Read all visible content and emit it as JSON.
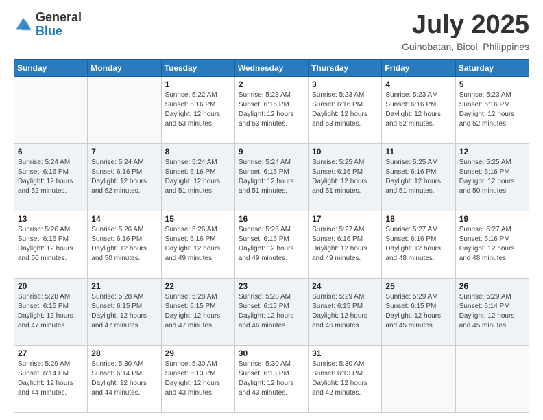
{
  "header": {
    "logo_general": "General",
    "logo_blue": "Blue",
    "month": "July 2025",
    "location": "Guinobatan, Bicol, Philippines"
  },
  "days_of_week": [
    "Sunday",
    "Monday",
    "Tuesday",
    "Wednesday",
    "Thursday",
    "Friday",
    "Saturday"
  ],
  "weeks": [
    [
      {
        "day": "",
        "sunrise": "",
        "sunset": "",
        "daylight": ""
      },
      {
        "day": "",
        "sunrise": "",
        "sunset": "",
        "daylight": ""
      },
      {
        "day": "1",
        "sunrise": "Sunrise: 5:22 AM",
        "sunset": "Sunset: 6:16 PM",
        "daylight": "Daylight: 12 hours and 53 minutes."
      },
      {
        "day": "2",
        "sunrise": "Sunrise: 5:23 AM",
        "sunset": "Sunset: 6:16 PM",
        "daylight": "Daylight: 12 hours and 53 minutes."
      },
      {
        "day": "3",
        "sunrise": "Sunrise: 5:23 AM",
        "sunset": "Sunset: 6:16 PM",
        "daylight": "Daylight: 12 hours and 53 minutes."
      },
      {
        "day": "4",
        "sunrise": "Sunrise: 5:23 AM",
        "sunset": "Sunset: 6:16 PM",
        "daylight": "Daylight: 12 hours and 52 minutes."
      },
      {
        "day": "5",
        "sunrise": "Sunrise: 5:23 AM",
        "sunset": "Sunset: 6:16 PM",
        "daylight": "Daylight: 12 hours and 52 minutes."
      }
    ],
    [
      {
        "day": "6",
        "sunrise": "Sunrise: 5:24 AM",
        "sunset": "Sunset: 6:16 PM",
        "daylight": "Daylight: 12 hours and 52 minutes."
      },
      {
        "day": "7",
        "sunrise": "Sunrise: 5:24 AM",
        "sunset": "Sunset: 6:16 PM",
        "daylight": "Daylight: 12 hours and 52 minutes."
      },
      {
        "day": "8",
        "sunrise": "Sunrise: 5:24 AM",
        "sunset": "Sunset: 6:16 PM",
        "daylight": "Daylight: 12 hours and 51 minutes."
      },
      {
        "day": "9",
        "sunrise": "Sunrise: 5:24 AM",
        "sunset": "Sunset: 6:16 PM",
        "daylight": "Daylight: 12 hours and 51 minutes."
      },
      {
        "day": "10",
        "sunrise": "Sunrise: 5:25 AM",
        "sunset": "Sunset: 6:16 PM",
        "daylight": "Daylight: 12 hours and 51 minutes."
      },
      {
        "day": "11",
        "sunrise": "Sunrise: 5:25 AM",
        "sunset": "Sunset: 6:16 PM",
        "daylight": "Daylight: 12 hours and 51 minutes."
      },
      {
        "day": "12",
        "sunrise": "Sunrise: 5:25 AM",
        "sunset": "Sunset: 6:16 PM",
        "daylight": "Daylight: 12 hours and 50 minutes."
      }
    ],
    [
      {
        "day": "13",
        "sunrise": "Sunrise: 5:26 AM",
        "sunset": "Sunset: 6:16 PM",
        "daylight": "Daylight: 12 hours and 50 minutes."
      },
      {
        "day": "14",
        "sunrise": "Sunrise: 5:26 AM",
        "sunset": "Sunset: 6:16 PM",
        "daylight": "Daylight: 12 hours and 50 minutes."
      },
      {
        "day": "15",
        "sunrise": "Sunrise: 5:26 AM",
        "sunset": "Sunset: 6:16 PM",
        "daylight": "Daylight: 12 hours and 49 minutes."
      },
      {
        "day": "16",
        "sunrise": "Sunrise: 5:26 AM",
        "sunset": "Sunset: 6:16 PM",
        "daylight": "Daylight: 12 hours and 49 minutes."
      },
      {
        "day": "17",
        "sunrise": "Sunrise: 5:27 AM",
        "sunset": "Sunset: 6:16 PM",
        "daylight": "Daylight: 12 hours and 49 minutes."
      },
      {
        "day": "18",
        "sunrise": "Sunrise: 5:27 AM",
        "sunset": "Sunset: 6:16 PM",
        "daylight": "Daylight: 12 hours and 48 minutes."
      },
      {
        "day": "19",
        "sunrise": "Sunrise: 5:27 AM",
        "sunset": "Sunset: 6:16 PM",
        "daylight": "Daylight: 12 hours and 48 minutes."
      }
    ],
    [
      {
        "day": "20",
        "sunrise": "Sunrise: 5:28 AM",
        "sunset": "Sunset: 6:15 PM",
        "daylight": "Daylight: 12 hours and 47 minutes."
      },
      {
        "day": "21",
        "sunrise": "Sunrise: 5:28 AM",
        "sunset": "Sunset: 6:15 PM",
        "daylight": "Daylight: 12 hours and 47 minutes."
      },
      {
        "day": "22",
        "sunrise": "Sunrise: 5:28 AM",
        "sunset": "Sunset: 6:15 PM",
        "daylight": "Daylight: 12 hours and 47 minutes."
      },
      {
        "day": "23",
        "sunrise": "Sunrise: 5:28 AM",
        "sunset": "Sunset: 6:15 PM",
        "daylight": "Daylight: 12 hours and 46 minutes."
      },
      {
        "day": "24",
        "sunrise": "Sunrise: 5:29 AM",
        "sunset": "Sunset: 6:15 PM",
        "daylight": "Daylight: 12 hours and 46 minutes."
      },
      {
        "day": "25",
        "sunrise": "Sunrise: 5:29 AM",
        "sunset": "Sunset: 6:15 PM",
        "daylight": "Daylight: 12 hours and 45 minutes."
      },
      {
        "day": "26",
        "sunrise": "Sunrise: 5:29 AM",
        "sunset": "Sunset: 6:14 PM",
        "daylight": "Daylight: 12 hours and 45 minutes."
      }
    ],
    [
      {
        "day": "27",
        "sunrise": "Sunrise: 5:29 AM",
        "sunset": "Sunset: 6:14 PM",
        "daylight": "Daylight: 12 hours and 44 minutes."
      },
      {
        "day": "28",
        "sunrise": "Sunrise: 5:30 AM",
        "sunset": "Sunset: 6:14 PM",
        "daylight": "Daylight: 12 hours and 44 minutes."
      },
      {
        "day": "29",
        "sunrise": "Sunrise: 5:30 AM",
        "sunset": "Sunset: 6:13 PM",
        "daylight": "Daylight: 12 hours and 43 minutes."
      },
      {
        "day": "30",
        "sunrise": "Sunrise: 5:30 AM",
        "sunset": "Sunset: 6:13 PM",
        "daylight": "Daylight: 12 hours and 43 minutes."
      },
      {
        "day": "31",
        "sunrise": "Sunrise: 5:30 AM",
        "sunset": "Sunset: 6:13 PM",
        "daylight": "Daylight: 12 hours and 42 minutes."
      },
      {
        "day": "",
        "sunrise": "",
        "sunset": "",
        "daylight": ""
      },
      {
        "day": "",
        "sunrise": "",
        "sunset": "",
        "daylight": ""
      }
    ]
  ]
}
